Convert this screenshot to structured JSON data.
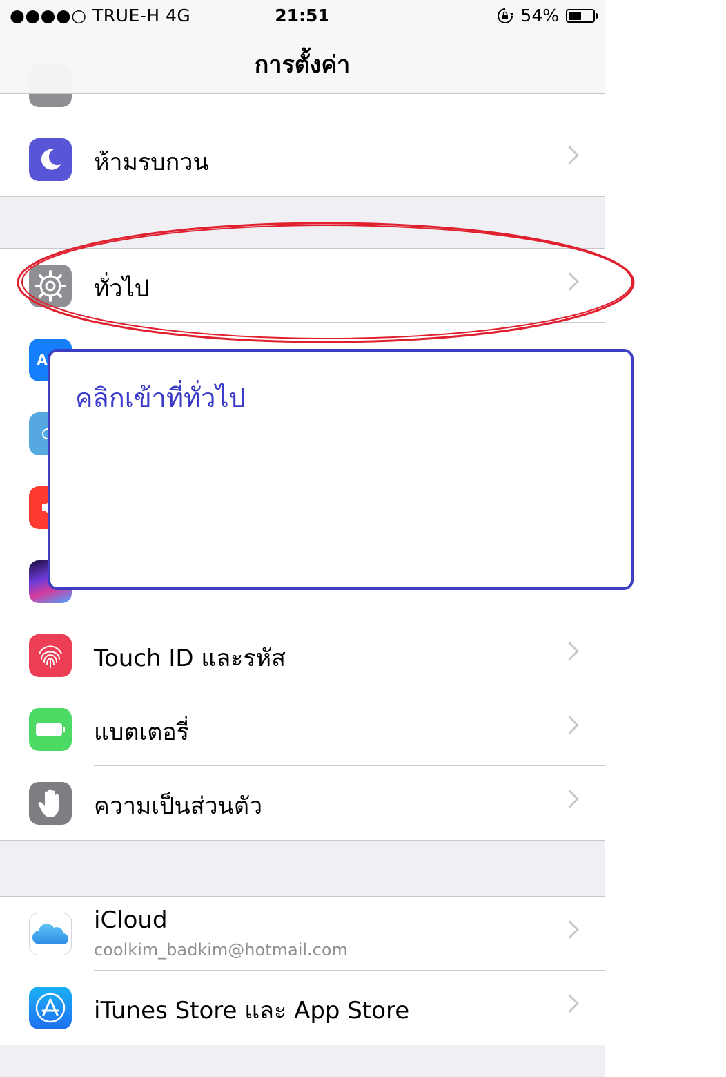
{
  "status_bar": {
    "carrier": "●●●●○ TRUE-H   4G",
    "time": "21:51",
    "battery_percent": "54%",
    "battery_level": 0.54
  },
  "nav": {
    "title": "การตั้งค่า"
  },
  "groups": {
    "top": {
      "dnd_label": "ห้ามรบกวน"
    },
    "general": {
      "general_label": "ทั่วไป",
      "touchid_label": "Touch ID และรหัส",
      "battery_label": "แบตเตอรี่",
      "privacy_label": "ความเป็นส่วนตัว"
    },
    "accounts": {
      "icloud_label": "iCloud",
      "icloud_email": "coolkim_badkim@hotmail.com",
      "itunes_label": "iTunes Store และ App Store"
    }
  },
  "annotation": {
    "callout_text": "คลิกเข้าที่ทั่วไป",
    "callout_color": "#3e3ec4",
    "highlight_color": "#e0202e"
  },
  "colors": {
    "background": "#efeff4",
    "separator": "#c8c7cc",
    "chevron": "#c7c7cc"
  }
}
